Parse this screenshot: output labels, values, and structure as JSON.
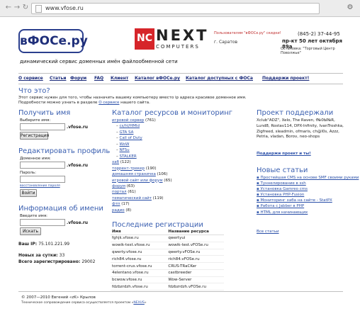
{
  "browser": {
    "url": "www.vfose.ru"
  },
  "header": {
    "logo_text": "вФОСе.ру",
    "tagline": "динамический сервис доменных имён файлообменной сети"
  },
  "banner": {
    "brand_short": "NC",
    "brand_top": "NEXT",
    "brand_bottom": "COMPUTERS",
    "promo": "Пользователям \"вФОСе.ру\" скидки!",
    "phone": "(845-2) 37-44-95",
    "city": "г. Саратов",
    "address": "пр-кт 50 лет октября 89а",
    "stop": "Остановка: \"Торговый Центр Поволжье\""
  },
  "menu": [
    {
      "label": "О сервисе"
    },
    {
      "label": "Статьи"
    },
    {
      "label": "Форум"
    },
    {
      "label": "FAQ"
    },
    {
      "label": "Клиент"
    },
    {
      "label": "Каталог вФОСе.ру"
    },
    {
      "label": "Каталог доступных с ФОСа"
    },
    {
      "label": "Поддержи проект!"
    }
  ],
  "intro": {
    "title": "Что это?",
    "line1": "Этот сервис нужен для того, чтобы назначить вашему компьютеру вместо ip адреса красивое доменное имя.",
    "line2_a": "Подробности можно узнать в разделе ",
    "line2_link": "О сервисе",
    "line2_b": " нашего сайта."
  },
  "get_name": {
    "title": "Получить имя",
    "label": "Выберите имя:",
    "suffix": ".vfose.ru",
    "button": "Регистрация"
  },
  "edit_profile": {
    "title": "Редактировать профиль",
    "domain_label": "Доменное имя:",
    "suffix": ".vfose.ru",
    "password_label": "Пароль:",
    "restore_link": "восстановление пароля",
    "button": "Войти"
  },
  "name_info": {
    "title": "Информация об имени",
    "label": "Введите имя:",
    "suffix": ".vfose.ru",
    "button": "Искать"
  },
  "stats": {
    "ip_label": "Ваш IP:",
    "ip_value": "75.101.221.99",
    "new_label": "Новых за сутки:",
    "new_value": "33",
    "total_label": "Всего зарегистрировано:",
    "total_value": "29002"
  },
  "catalog": {
    "title": "Каталог ресурсов и мониторинг",
    "items": [
      {
        "link": "игровой сервер",
        "count": " (761)",
        "indent": false
      },
      {
        "link": "cs/hl/HMld",
        "count": "",
        "indent": true
      },
      {
        "link": "GTA SA",
        "count": "",
        "indent": true
      },
      {
        "link": "Call of Duty",
        "count": "",
        "indent": true
      },
      {
        "link": "WoW",
        "count": "",
        "indent": true
      },
      {
        "link": "NFSu",
        "count": "",
        "indent": true
      },
      {
        "link": "STALKER",
        "count": "",
        "indent": true
      },
      {
        "link": "хаб",
        "count": " (122)",
        "indent": false
      },
      {
        "link": "торрент-трекер",
        "count": " (190)",
        "indent": false
      },
      {
        "link": "домашняя страничка",
        "count": " (106)",
        "indent": false
      },
      {
        "link": "игровой сайт или форум",
        "count": " (65)",
        "indent": false
      },
      {
        "link": "форум",
        "count": " (63)",
        "indent": false
      },
      {
        "link": "портал",
        "count": " (61)",
        "indent": false
      },
      {
        "link": "тематический сайт",
        "count": " (119)",
        "indent": false
      },
      {
        "link": "фтп",
        "count": " (17)",
        "indent": false
      },
      {
        "link": "радио",
        "count": " (8)",
        "indent": false
      }
    ]
  },
  "registrations": {
    "title": "Последние регистрации",
    "columns": [
      "Имя",
      "Название ресурса"
    ],
    "rows": [
      [
        "fghjk.vfose.ru",
        "qwertyui"
      ],
      [
        "wowik-test.vfose.ru",
        "wowik-test.vFOSe.ru"
      ],
      [
        "qwerty.vfose.ru",
        "qwerty.vFOSe.ru"
      ],
      [
        "rich84.vfose.ru",
        "rich84.vFOSe.ru"
      ],
      [
        "torrent-crus.vfose.ru",
        "CRUS-TRaCKer"
      ],
      [
        "4elentano.vfose.ru",
        "castbreeder"
      ],
      [
        "bcwow.vfose.ru",
        "Wow-Server"
      ],
      [
        "fdzbzrdzh.vfose.ru",
        "fdzbzrdzh.vFOSe.ru"
      ]
    ]
  },
  "support": {
    "title": "Проект поддержали",
    "text": "Xclub\"ADZ\", Xelo, The Raven, f№0Ы№R, Lund8, Rostav114, DPX-Infinity, IvanTroshka, Zigfreed, sleadmin, ofmaris, ch@l0s, Azzz, Petria, vladan, Borov, neo-shops",
    "link": "Поддержи проект и ты!"
  },
  "news": {
    "title": "Новые статьи",
    "items": [
      "Простейшая CMS на основе SMF своими руками",
      "Туннелирование в ssh",
      "Установка Gamreo cms",
      "Установка PHP-Fusion",
      "Мониторинг хаба на сайте - StatPX",
      "Работа с Jabber в PHP",
      "HTML для начинающих"
    ],
    "all_link": "Все статьи"
  },
  "footer": {
    "copyright": "© 2007—2010 Евгений «zK» Крылов",
    "note_a": "Техническое сопровождение сервиса осуществляется проектом «",
    "note_link": "NEXUS",
    "note_b": "»"
  }
}
